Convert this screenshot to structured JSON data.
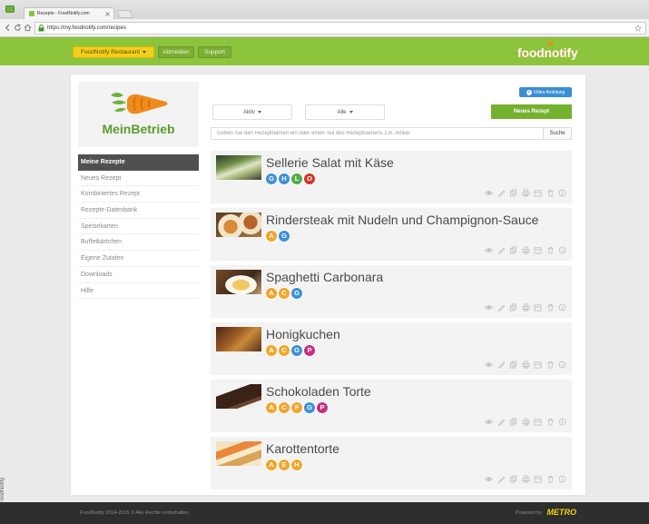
{
  "browser": {
    "tab_title": "Rezepte - FoodNotify.com",
    "url": "https://my.foodnotify.com/recipes"
  },
  "header": {
    "account_button": "FoodNotify Restaurant",
    "logout_button": "Abmelden",
    "support_button": "Support",
    "logo": "foodnotify"
  },
  "brand": {
    "name": "MeinBetrieb"
  },
  "sidebar": {
    "active_index": 0,
    "items": [
      "Meine Rezepte",
      "Neues Rezept",
      "Kombiniertes Rezept",
      "Rezepte-Datenbank",
      "Speisekarten",
      "Buffetkärtchen",
      "Eigene Zutaten",
      "Downloads",
      "Hilfe"
    ]
  },
  "toolbar": {
    "video_button": "Video Anleitung",
    "status_filter": "Aktiv",
    "category_filter": "Alle",
    "new_recipe_button": "Neues Rezept"
  },
  "search": {
    "placeholder": "Geben Sie den Rezeptnamen ein oder einen Teil des Rezeptnamens z.B. Artikel",
    "button": "Suche"
  },
  "recipes": [
    {
      "title": "Sellerie Salat mit Käse",
      "allergens": [
        {
          "letter": "G",
          "color": "#3d8fd8"
        },
        {
          "letter": "H",
          "color": "#3d8fd8"
        },
        {
          "letter": "L",
          "color": "#4fae4a"
        },
        {
          "letter": "O",
          "color": "#d2352b"
        }
      ]
    },
    {
      "title": "Rindersteak mit Nudeln und Champignon-Sauce",
      "allergens": [
        {
          "letter": "A",
          "color": "#f2a52b"
        },
        {
          "letter": "G",
          "color": "#3d8fd8"
        }
      ]
    },
    {
      "title": "Spaghetti Carbonara",
      "allergens": [
        {
          "letter": "A",
          "color": "#f2a52b"
        },
        {
          "letter": "C",
          "color": "#f2a52b"
        },
        {
          "letter": "G",
          "color": "#3d8fd8"
        }
      ]
    },
    {
      "title": "Honigkuchen",
      "allergens": [
        {
          "letter": "A",
          "color": "#f2a52b"
        },
        {
          "letter": "C",
          "color": "#f2a52b"
        },
        {
          "letter": "G",
          "color": "#3d8fd8"
        },
        {
          "letter": "P",
          "color": "#c8307a"
        }
      ]
    },
    {
      "title": "Schokoladen Torte",
      "allergens": [
        {
          "letter": "A",
          "color": "#f2a52b"
        },
        {
          "letter": "C",
          "color": "#f2a52b"
        },
        {
          "letter": "F",
          "color": "#f2a52b"
        },
        {
          "letter": "G",
          "color": "#3d8fd8"
        },
        {
          "letter": "P",
          "color": "#c8307a"
        }
      ]
    },
    {
      "title": "Karottentorte",
      "allergens": [
        {
          "letter": "A",
          "color": "#f2a52b"
        },
        {
          "letter": "E",
          "color": "#f2a52b"
        },
        {
          "letter": "H",
          "color": "#f2a52b"
        }
      ]
    }
  ],
  "row_actions": [
    "eye-icon",
    "pencil-icon",
    "copy-icon",
    "print-icon",
    "archive-icon",
    "trash-icon",
    "info-icon"
  ],
  "footer": {
    "copyright": "FoodNotify 2014-2015 © Alle Rechte vorbehalten",
    "powered_by": "Powered by",
    "partner": "METRO"
  },
  "photo_credit": "Foto: FoodNotify",
  "colors": {
    "header_green": "#8cc43c",
    "account_yellow": "#f2cf1d",
    "action_green": "#74b12e",
    "video_blue": "#3a8ed6",
    "sidebar_active": "#505050",
    "footer_bg": "#2e2e2e",
    "partner_yellow": "#f3d20f",
    "brand_green": "#5d9b2e",
    "carrot_orange": "#f08a1c"
  }
}
